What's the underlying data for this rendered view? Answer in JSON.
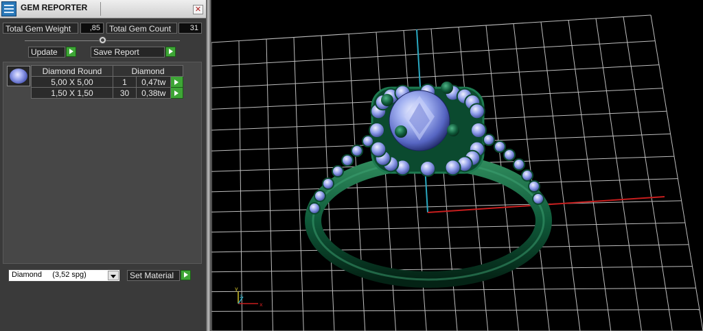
{
  "window": {
    "title": "GEM REPORTER"
  },
  "summary": {
    "total_weight_label": "Total Gem Weight",
    "total_weight_value": ",85",
    "total_count_label": "Total Gem Count",
    "total_count_value": "31"
  },
  "buttons": {
    "update": "Update",
    "save_report": "Save Report",
    "set_material": "Set Material"
  },
  "gem_table": {
    "headers": [
      "Diamond Round",
      "Diamond"
    ],
    "rows": [
      {
        "size": "5,00 X 5,00",
        "count": "1",
        "weight": "0,47tw"
      },
      {
        "size": "1,50 X 1,50",
        "count": "30",
        "weight": "0,38tw"
      }
    ]
  },
  "material": {
    "selected": "Diamond     (3,52 spg)"
  },
  "viewport": {
    "axis_x_label": "x",
    "axis_y_label": "y",
    "axis_z_label": "z"
  },
  "colors": {
    "metal": "#0f5a3a",
    "stone": "#8fa2ee",
    "grid": "#bfbfbf",
    "axis_x": "#c81e1e",
    "axis_z": "#2aa9c2",
    "go_button": "#3ea636"
  },
  "icons": [
    "app-logo-icon",
    "close-icon",
    "go-arrow-icon",
    "dropdown-arrow-icon",
    "diamond-thumbnail-icon"
  ]
}
